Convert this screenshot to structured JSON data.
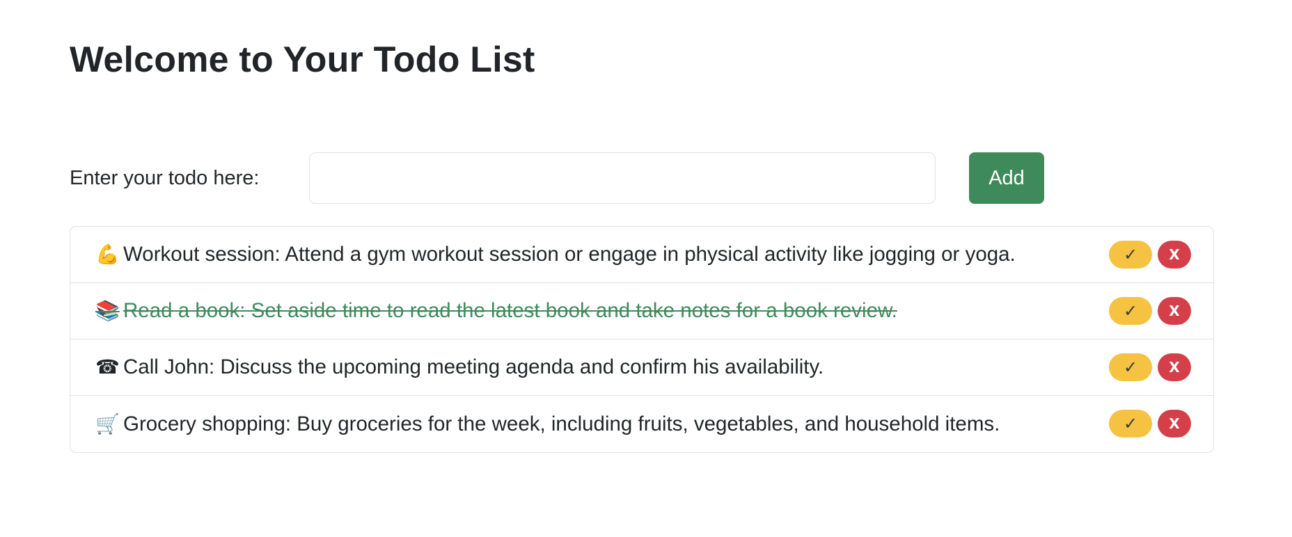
{
  "page": {
    "title": "Welcome to Your Todo List"
  },
  "form": {
    "label": "Enter your todo here:",
    "input_value": "",
    "placeholder": "",
    "add_label": "Add"
  },
  "todos": [
    {
      "icon": "flexed-biceps-icon",
      "emoji": "💪",
      "text": "Workout session: Attend a gym workout session or engage in physical activity like jogging or yoga.",
      "completed": false,
      "check_label": "✓",
      "delete_label": "X"
    },
    {
      "icon": "books-icon",
      "emoji": "📚",
      "text": "Read a book: Set aside time to read the latest book and take notes for a book review.",
      "completed": true,
      "check_label": "✓",
      "delete_label": "X"
    },
    {
      "icon": "telephone-icon",
      "emoji": "☎",
      "text": "Call John: Discuss the upcoming meeting agenda and confirm his availability.",
      "completed": false,
      "check_label": "✓",
      "delete_label": "X"
    },
    {
      "icon": "shopping-cart-icon",
      "emoji": "🛒",
      "text": "Grocery shopping: Buy groceries for the week, including fruits, vegetables, and household items.",
      "completed": false,
      "check_label": "✓",
      "delete_label": "X"
    }
  ],
  "colors": {
    "add_button": "#3e8a5a",
    "completed_text": "#3e8a5a",
    "check_button": "#f5c242",
    "delete_button": "#d43f4a",
    "border": "#dee2e6"
  }
}
